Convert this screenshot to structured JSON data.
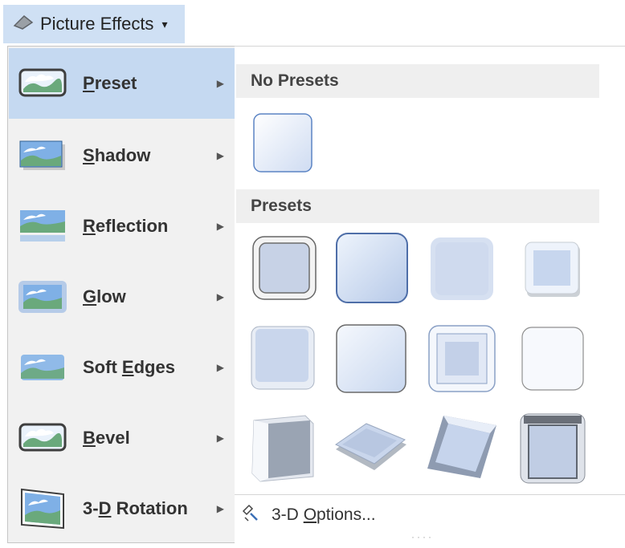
{
  "ribbon": {
    "label": "Picture Effects",
    "caret": "▾"
  },
  "menu": {
    "items": [
      {
        "pre": "",
        "u": "P",
        "post": "reset",
        "selected": true
      },
      {
        "pre": "",
        "u": "S",
        "post": "hadow",
        "selected": false
      },
      {
        "pre": "",
        "u": "R",
        "post": "eflection",
        "selected": false
      },
      {
        "pre": "",
        "u": "G",
        "post": "low",
        "selected": false
      },
      {
        "pre": "Soft ",
        "u": "E",
        "post": "dges",
        "selected": false
      },
      {
        "pre": "",
        "u": "B",
        "post": "evel",
        "selected": false
      },
      {
        "pre": "3-",
        "u": "D",
        "post": " Rotation",
        "selected": false
      }
    ],
    "arrow": "▶"
  },
  "gallery": {
    "no_presets_header": "No Presets",
    "presets_header": "Presets",
    "options": {
      "pre": "3-D ",
      "u": "O",
      "post": "ptions..."
    },
    "grip": "····",
    "top_dots": "······  ·······"
  },
  "colors": {
    "accent": "#c5d9f1",
    "tile_fill": "#dce6f5",
    "tile_edge": "#8aa8d6"
  }
}
